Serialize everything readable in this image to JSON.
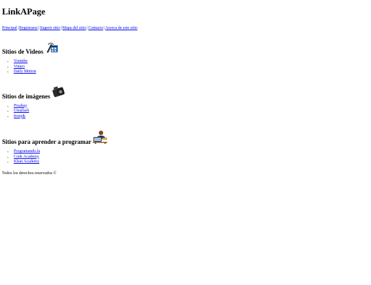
{
  "site": {
    "title": "LinkAPage"
  },
  "nav": [
    "Principal",
    "Registrarse",
    "Sugerir sitio",
    "Mapa del sitio",
    "Contacto",
    "Acerca de este sitio"
  ],
  "sections": [
    {
      "title": "Sitios de Videos",
      "icon": "video-film-icon",
      "links": [
        "Youtube",
        "Vimeo",
        "Daily Motion"
      ]
    },
    {
      "title": "Sitios de imágenes",
      "icon": "camera-icon",
      "links": [
        "Pixabay",
        "Unsplash",
        "freepik"
      ]
    },
    {
      "title": "Sitios para aprender a programar",
      "icon": "programmer-icon",
      "links": [
        "Programando.la",
        "Code Academy",
        "Khan Academy"
      ]
    }
  ],
  "footer": {
    "text": "Todos los derechos reservados ©"
  }
}
